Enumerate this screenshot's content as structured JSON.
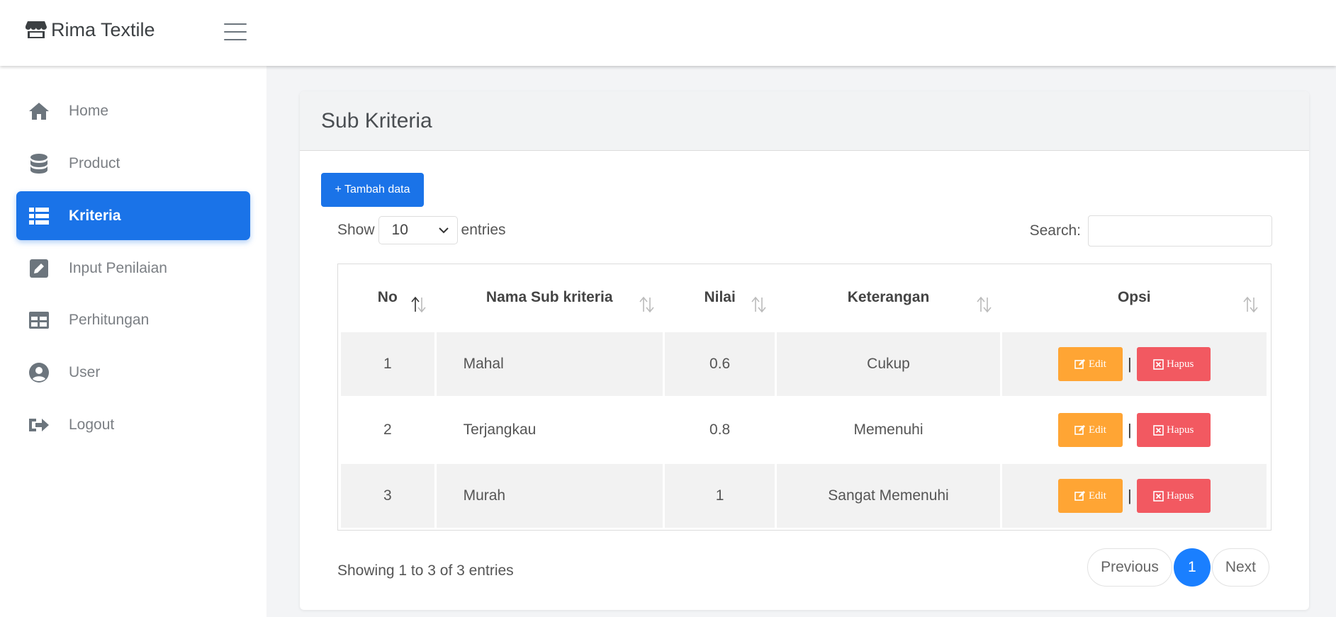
{
  "header": {
    "brand": "Rima Textile"
  },
  "sidebar": {
    "items": [
      {
        "label": "Home",
        "icon": "home-icon"
      },
      {
        "label": "Product",
        "icon": "database-icon"
      },
      {
        "label": "Kriteria",
        "icon": "list-icon",
        "active": true
      },
      {
        "label": "Input Penilaian",
        "icon": "edit-icon"
      },
      {
        "label": "Perhitungan",
        "icon": "table-icon"
      },
      {
        "label": "User",
        "icon": "user-circle-icon"
      },
      {
        "label": "Logout",
        "icon": "logout-icon"
      }
    ]
  },
  "main": {
    "title": "Sub Kriteria",
    "add_button": "+ Tambah data",
    "show_label": "Show",
    "entries_label": "entries",
    "page_length": "10",
    "search_label": "Search:",
    "search_value": "",
    "columns": [
      "No",
      "Nama Sub kriteria",
      "Nilai",
      "Keterangan",
      "Opsi"
    ],
    "rows": [
      {
        "no": "1",
        "nama": "Mahal",
        "nilai": "0.6",
        "keterangan": "Cukup"
      },
      {
        "no": "2",
        "nama": "Terjangkau",
        "nilai": "0.8",
        "keterangan": "Memenuhi"
      },
      {
        "no": "3",
        "nama": "Murah",
        "nilai": "1",
        "keterangan": "Sangat Memenuhi"
      }
    ],
    "edit_label": "Edit",
    "delete_label": "Hapus",
    "separator": "|",
    "info": "Showing 1 to 3 of 3 entries",
    "pagination": {
      "previous": "Previous",
      "current": "1",
      "next": "Next"
    }
  },
  "colors": {
    "primary": "#1a73e8",
    "edit": "#ffa534",
    "delete": "#f25961",
    "page_active": "#1a7fff"
  }
}
